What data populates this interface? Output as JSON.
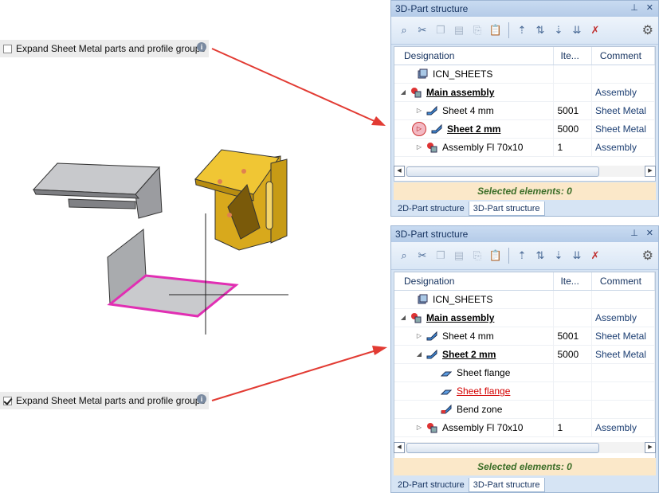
{
  "option_top": {
    "label": "Expand Sheet Metal parts and profile groups",
    "checked": false
  },
  "option_bottom": {
    "label": "Expand Sheet Metal parts and profile groups",
    "checked": true
  },
  "panel_top": {
    "title": "3D-Part structure",
    "pin": "⊥",
    "close": "✕",
    "headers": [
      "Designation",
      "Ite...",
      "Comment"
    ],
    "rows": [
      {
        "label": "ICN_SHEETS",
        "item": "",
        "comment": ""
      },
      {
        "label": "Main assembly",
        "item": "",
        "comment": "Assembly"
      },
      {
        "label": "Sheet 4 mm",
        "item": "5001",
        "comment": "Sheet Metal"
      },
      {
        "label": "Sheet 2 mm",
        "item": "5000",
        "comment": "Sheet Metal"
      },
      {
        "label": "Assembly Fl 70x10",
        "item": "1",
        "comment": "Assembly"
      }
    ],
    "status": "Selected elements: 0",
    "tabs": [
      "2D-Part structure",
      "3D-Part structure"
    ]
  },
  "panel_bottom": {
    "title": "3D-Part structure",
    "pin": "⊥",
    "close": "✕",
    "headers": [
      "Designation",
      "Ite...",
      "Comment"
    ],
    "rows": [
      {
        "label": "ICN_SHEETS",
        "item": "",
        "comment": ""
      },
      {
        "label": "Main assembly",
        "item": "",
        "comment": "Assembly"
      },
      {
        "label": "Sheet 4 mm",
        "item": "5001",
        "comment": "Sheet Metal"
      },
      {
        "label": "Sheet 2 mm",
        "item": "5000",
        "comment": "Sheet Metal"
      },
      {
        "label": "Sheet flange",
        "item": "",
        "comment": ""
      },
      {
        "label": "Sheet flange",
        "item": "",
        "comment": ""
      },
      {
        "label": "Bend zone",
        "item": "",
        "comment": ""
      },
      {
        "label": "Assembly Fl 70x10",
        "item": "1",
        "comment": "Assembly"
      }
    ],
    "status": "Selected elements: 0",
    "tabs": [
      "2D-Part structure",
      "3D-Part structure"
    ]
  },
  "colors": {
    "arrow": "#e23b33",
    "highlight": "#e12fb3",
    "gold": "#e3b41d"
  }
}
